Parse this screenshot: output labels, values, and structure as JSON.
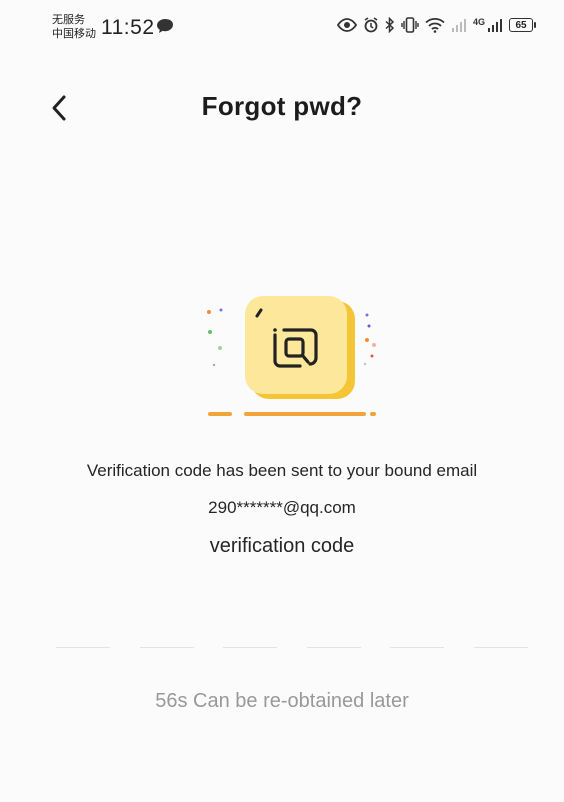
{
  "status_bar": {
    "carrier_line1": "无服务",
    "carrier_line2": "中国移动",
    "time": "11:52",
    "network_label": "4G",
    "battery_level": "65",
    "icons": [
      "message-icon",
      "eye-icon",
      "alarm-icon",
      "bluetooth-icon",
      "vibrate-icon",
      "wifi-icon",
      "signal-icon",
      "battery-icon"
    ]
  },
  "header": {
    "title": "Forgot pwd?",
    "back_icon": "chevron-left-icon"
  },
  "content": {
    "message": "Verification code has been sent to your bound email",
    "email": "290*******@qq.com",
    "code_label": "verification code",
    "code_slots": [
      "",
      "",
      "",
      "",
      "",
      ""
    ],
    "resend_text": "56s Can be re-obtained later"
  },
  "colors": {
    "accent_orange": "#f0a43a",
    "card_yellow": "#fde79b",
    "card_shadow": "#f4c534",
    "icon_stroke": "#222222",
    "muted_text": "#999999"
  }
}
